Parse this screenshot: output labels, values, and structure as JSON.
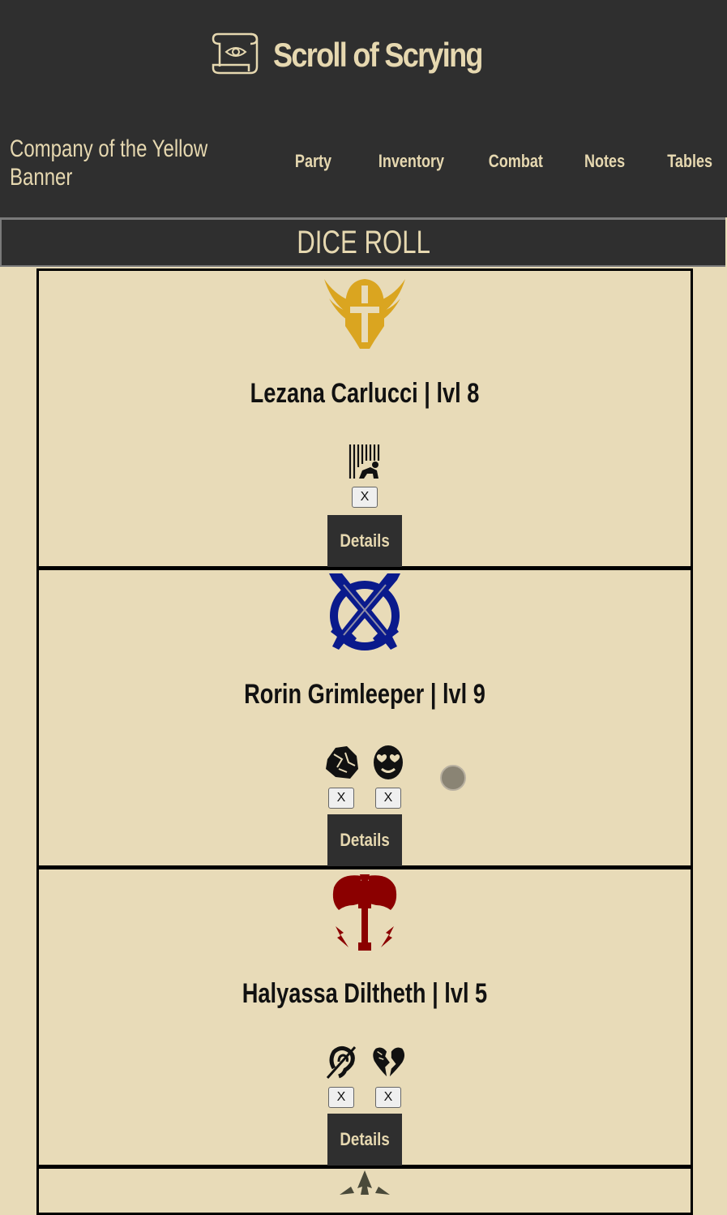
{
  "app": {
    "title": "Scroll of Scrying",
    "logo_icon": "scroll-eye-icon"
  },
  "company": {
    "name": "Company of the Yellow Banner"
  },
  "nav": {
    "items": [
      "Party",
      "Inventory",
      "Combat",
      "Notes",
      "Tables"
    ]
  },
  "dice_roll": {
    "label": "DICE ROLL"
  },
  "party": [
    {
      "name_line": "Lezana Carlucci | lvl 8",
      "class_icon": "winged-helmet-icon",
      "class_color": "#daa520",
      "conditions": [
        {
          "icon": "prisoner-restrained-icon",
          "remove_label": "X"
        }
      ],
      "details_label": "Details"
    },
    {
      "name_line": "Rorin Grimleeper | lvl 9",
      "class_icon": "crossed-swords-icon",
      "class_color": "#0a1a8c",
      "conditions": [
        {
          "icon": "stone-petrified-icon",
          "remove_label": "X"
        },
        {
          "icon": "charmed-heart-eyes-icon",
          "remove_label": "X"
        }
      ],
      "details_label": "Details"
    },
    {
      "name_line": "Halyassa Diltheth | lvl 5",
      "class_icon": "lightning-axe-icon",
      "class_color": "#8b0000",
      "conditions": [
        {
          "icon": "deafened-ear-icon",
          "remove_label": "X"
        },
        {
          "icon": "broken-heart-icon",
          "remove_label": "X"
        }
      ],
      "details_label": "Details"
    }
  ],
  "next_card": {
    "class_icon": "tree-icon",
    "class_color": "#4a4a3a"
  }
}
